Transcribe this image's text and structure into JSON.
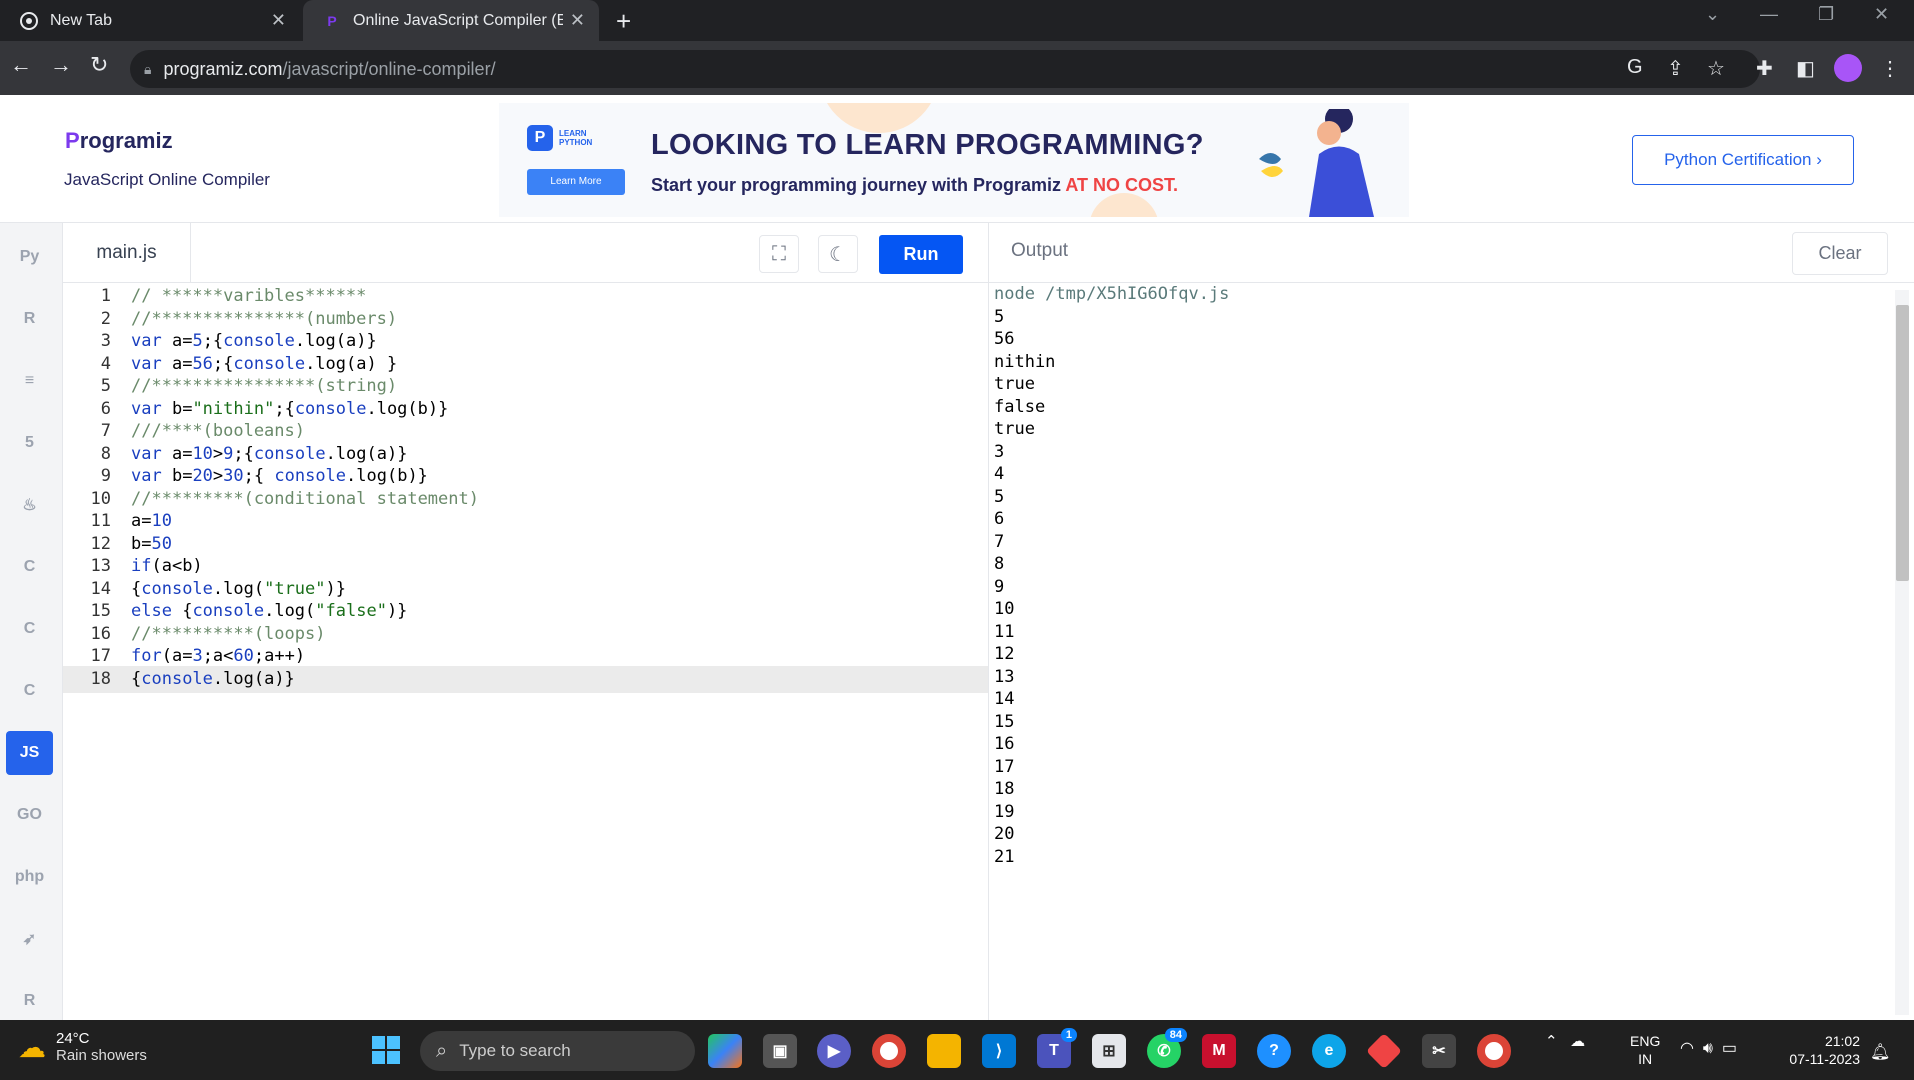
{
  "browser": {
    "tabs": [
      {
        "label": "New Tab"
      },
      {
        "label": "Online JavaScript Compiler (Edit"
      }
    ],
    "url_domain": "programiz.com",
    "url_path": "/javascript/online-compiler/"
  },
  "site": {
    "logo_text": "rogramiz",
    "logo_p": "P",
    "subtitle": "JavaScript Online Compiler",
    "banner": {
      "badge_line1": "LEARN",
      "badge_line2": "PYTHON",
      "button": "Learn More",
      "headline": "LOOKING TO LEARN PROGRAMMING?",
      "subline": "Start your programming journey with Programiz ",
      "highlight": "AT NO COST."
    },
    "cert_button": "Python Certification ›"
  },
  "languages": [
    {
      "name": "python-icon",
      "glyph": "Py"
    },
    {
      "name": "r-icon",
      "glyph": "R"
    },
    {
      "name": "sql-icon",
      "glyph": "≡"
    },
    {
      "name": "html-icon",
      "glyph": "5"
    },
    {
      "name": "java-icon",
      "glyph": "♨"
    },
    {
      "name": "c-icon",
      "glyph": "C"
    },
    {
      "name": "cpp-icon",
      "glyph": "C"
    },
    {
      "name": "csharp-icon",
      "glyph": "C"
    },
    {
      "name": "js-icon",
      "glyph": "JS",
      "active": true
    },
    {
      "name": "go-icon",
      "glyph": "GO"
    },
    {
      "name": "php-icon",
      "glyph": "php"
    },
    {
      "name": "swift-icon",
      "glyph": "➶"
    },
    {
      "name": "rust-icon",
      "glyph": "R"
    }
  ],
  "editor": {
    "filename": "main.js",
    "run_label": "Run",
    "lines": [
      "// ******varibles******",
      "//***************(numbers)",
      "var a=5;{console.log(a)}",
      "var a=56;{console.log(a) }",
      "//****************(string)",
      "var b=\"nithin\";{console.log(b)}",
      "///****(booleans)",
      "var a=10>9;{console.log(a)}",
      "var b=20>30;{ console.log(b)}",
      "//*********(conditional statement)",
      "a=10",
      "b=50",
      "if(a<b)",
      "{console.log(\"true\")}",
      "else {console.log(\"false\")}",
      "//**********(loops)",
      "for(a=3;a<60;a++)",
      "{console.log(a)}"
    ],
    "current_line": 18
  },
  "output": {
    "label": "Output",
    "clear_label": "Clear",
    "lines": [
      "node /tmp/X5hIG6Ofqv.js",
      "5",
      "56",
      "nithin",
      "true",
      "false",
      "true",
      "3",
      "4",
      "5",
      "6",
      "7",
      "8",
      "9",
      "10",
      "11",
      "12",
      "13",
      "14",
      "15",
      "16",
      "17",
      "18",
      "19",
      "20",
      "21"
    ]
  },
  "taskbar": {
    "temp": "24°C",
    "weather": "Rain showers",
    "search_placeholder": "Type to search",
    "teams_badge": "1",
    "whatsapp_badge": "84",
    "lang_line1": "ENG",
    "lang_line2": "IN",
    "time": "21:02",
    "date": "07-11-2023"
  },
  "colors": {
    "accent": "#0556f3",
    "chrome_dark": "#202124",
    "taskbar": "#202020"
  }
}
